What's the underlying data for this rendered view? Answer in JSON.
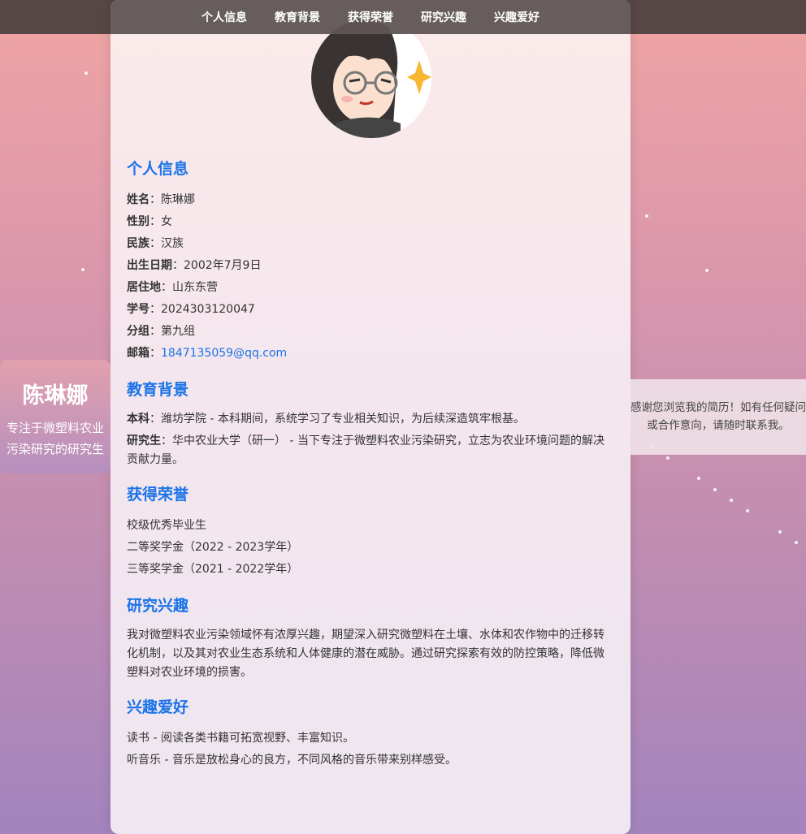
{
  "nav": [
    "个人信息",
    "教育背景",
    "获得荣誉",
    "研究兴趣",
    "兴趣爱好"
  ],
  "sidebar": {
    "name": "陈琳娜",
    "tagline": "专注于微塑料农业污染研究的研究生"
  },
  "contact_note": "感谢您浏览我的简历！如有任何疑问或合作意向，请随时联系我。",
  "personal": {
    "title": "个人信息",
    "items": [
      {
        "label": "姓名",
        "value": "陈琳娜"
      },
      {
        "label": "性别",
        "value": "女"
      },
      {
        "label": "民族",
        "value": "汉族"
      },
      {
        "label": "出生日期",
        "value": "2002年7月9日"
      },
      {
        "label": "居住地",
        "value": "山东东营"
      },
      {
        "label": "学号",
        "value": "2024303120047"
      },
      {
        "label": "分组",
        "value": "第九组"
      },
      {
        "label": "邮箱",
        "value": "1847135059@qq.com"
      }
    ]
  },
  "education": {
    "title": "教育背景",
    "items": [
      {
        "label": "本科",
        "value": "潍坊学院 - 本科期间，系统学习了专业相关知识，为后续深造筑牢根基。"
      },
      {
        "label": "研究生",
        "value": "华中农业大学（研一） - 当下专注于微塑料农业污染研究，立志为农业环境问题的解决贡献力量。"
      }
    ]
  },
  "honors": {
    "title": "获得荣誉",
    "items": [
      "校级优秀毕业生",
      "二等奖学金（2022 - 2023学年）",
      "三等奖学金（2021 - 2022学年）"
    ]
  },
  "research": {
    "title": "研究兴趣",
    "text": "我对微塑料农业污染领域怀有浓厚兴趣，期望深入研究微塑料在土壤、水体和农作物中的迁移转化机制，以及其对农业生态系统和人体健康的潜在威胁。通过研究探索有效的防控策略，降低微塑料对农业环境的损害。"
  },
  "hobbies": {
    "title": "兴趣爱好",
    "items": [
      "读书 - 阅读各类书籍可拓宽视野、丰富知识。",
      "听音乐 - 音乐是放松身心的良方，不同风格的音乐带来别样感受。"
    ]
  },
  "colors": {
    "accent": "#1a73e8",
    "nav_bg": "#5f5555"
  }
}
